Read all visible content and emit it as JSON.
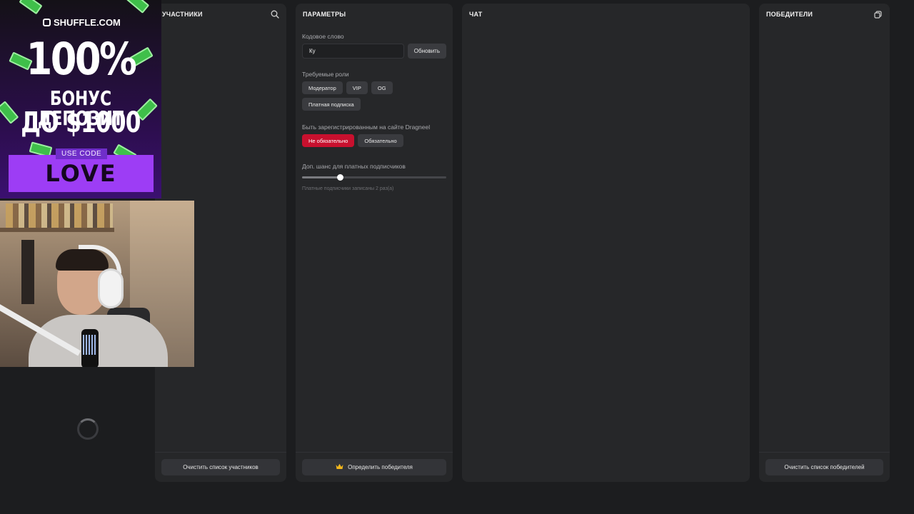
{
  "panels": {
    "participants": {
      "title": "УЧАСТНИКИ",
      "search_icon": "search-icon",
      "clear_button": "Очистить список участников"
    },
    "params": {
      "title": "ПАРАМЕТРЫ",
      "code_word_label": "Кодовое слово",
      "code_word_value": "Ку",
      "update_button": "Обновить",
      "required_roles_label": "Требуемые роли",
      "roles": [
        "Модератор",
        "VIP",
        "OG",
        "Платная подписка"
      ],
      "registration_label": "Быть зарегистрированным на сайте Dragneel",
      "registration_options": [
        "Не обязательно",
        "Обязательно"
      ],
      "registration_selected": "Не обязательно",
      "sub_chance_label": "Доп. шанс для платных подписчиков",
      "sub_chance_level": 0.26,
      "sub_chance_hint": "Платные подписчики записаны 2 раз(а)",
      "pick_winner_button": "Определить победителя",
      "pick_winner_icon": "crown-icon"
    },
    "chat": {
      "title": "ЧАТ"
    },
    "winners": {
      "title": "ПОБЕДИТЕЛИ",
      "copy_icon": "copy-icon",
      "clear_button": "Очистить список победителей"
    }
  },
  "overlay": {
    "brand": "SHUFFLE.COM",
    "headline": "100%",
    "line1": "БОНУС ДЕПОЗИТ",
    "line2": "ДО $1000",
    "use_code_label": "USE CODE",
    "code": "LOVE"
  },
  "colors": {
    "background": "#1c1d1f",
    "panel": "#262729",
    "accent_red": "#c8102e",
    "promo_purple": "#9d3df5"
  }
}
